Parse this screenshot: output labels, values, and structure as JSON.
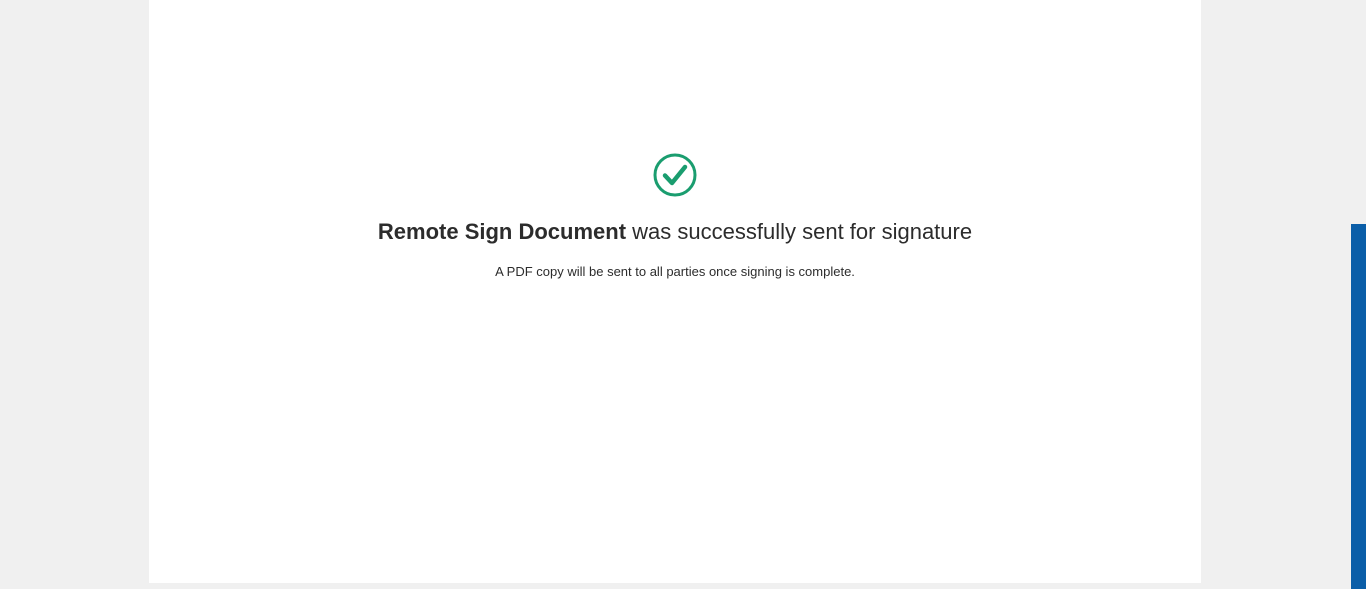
{
  "confirmation": {
    "icon": "check-circle-icon",
    "icon_color": "#1a9d6f",
    "document_name": "Remote Sign Document",
    "message_suffix": " was successfully sent for signature",
    "subtext": "A PDF copy will be sent to all parties once signing is complete."
  },
  "colors": {
    "page_background": "#f0f0f0",
    "card_background": "#ffffff",
    "side_tab": "#0b5ea8"
  }
}
